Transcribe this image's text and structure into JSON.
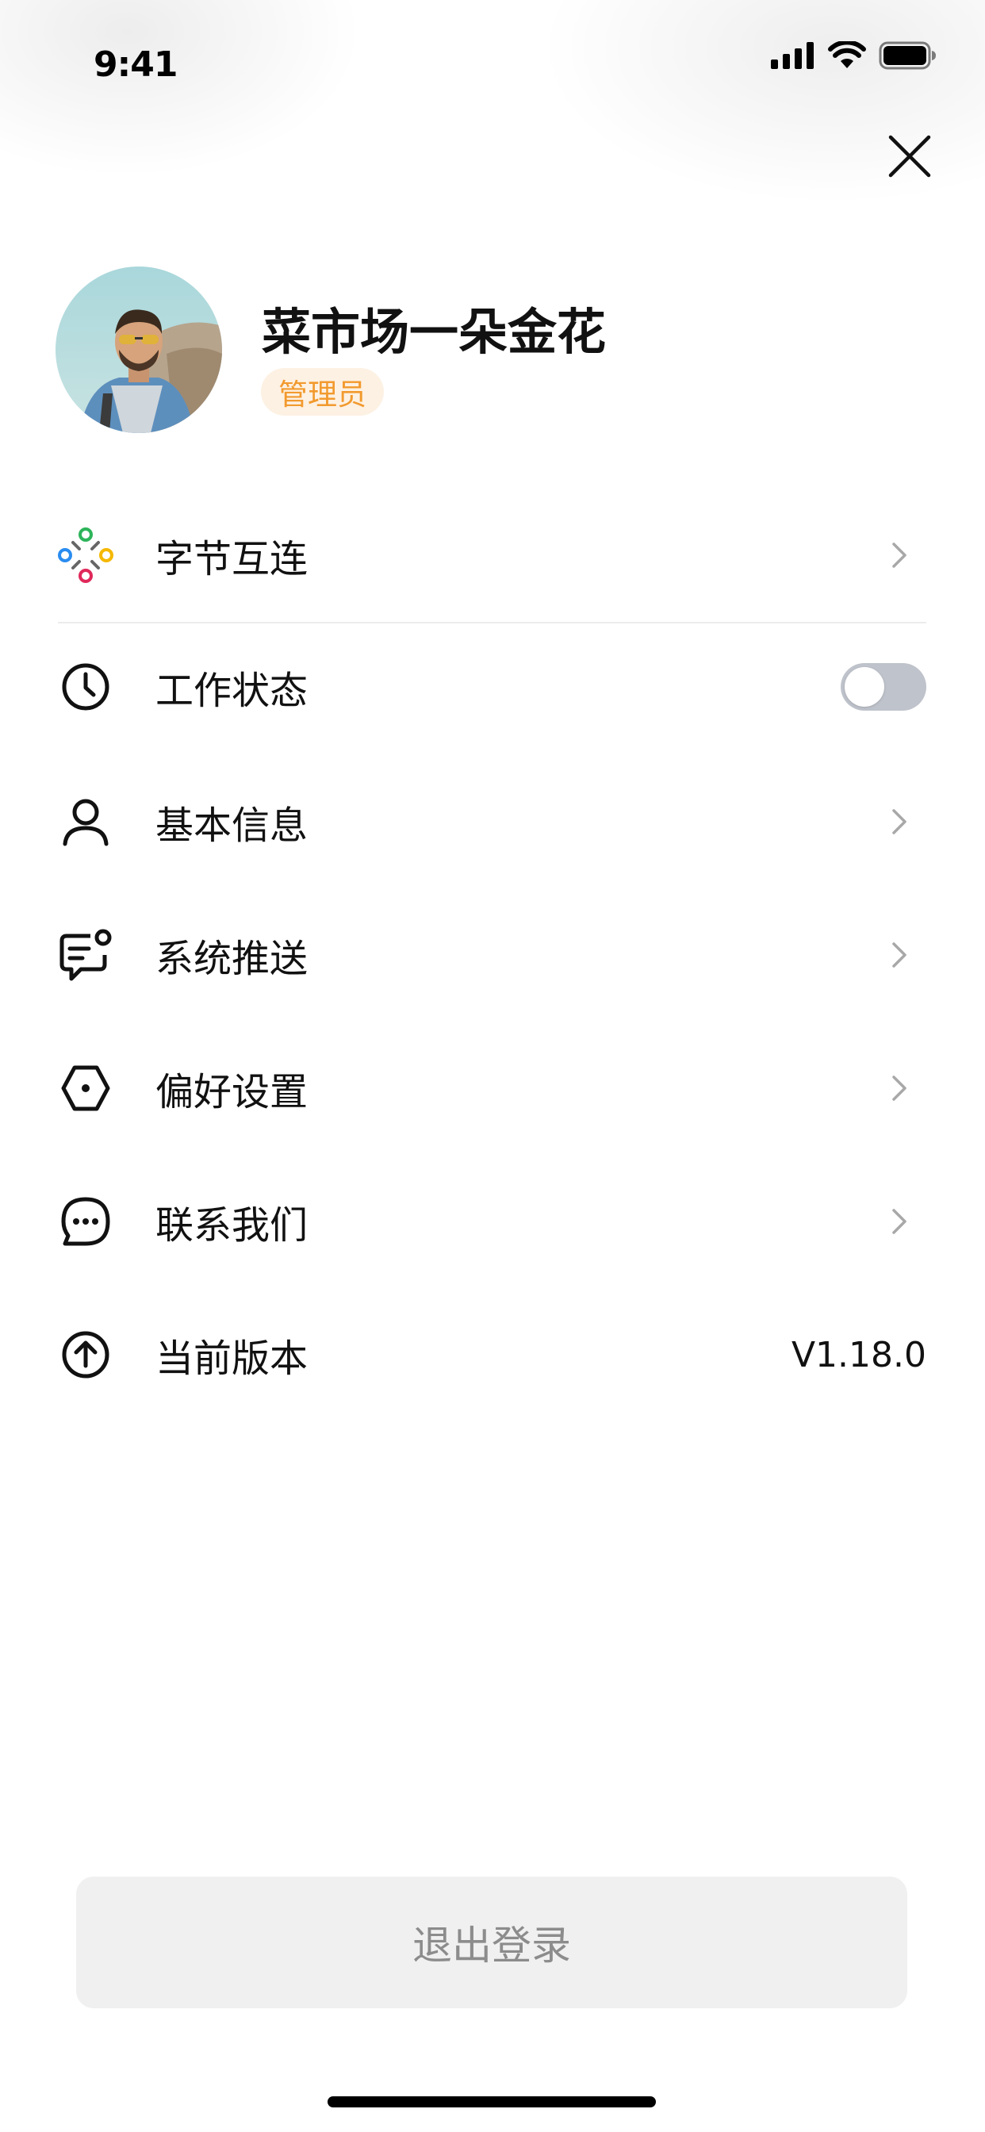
{
  "status_bar": {
    "time": "9:41"
  },
  "profile": {
    "name": "菜市场一朵金花",
    "role": "管理员"
  },
  "menu": {
    "items": [
      {
        "label": "字节互连",
        "icon": "app-grid-icon"
      },
      {
        "label": "工作状态",
        "icon": "clock-icon",
        "toggle_on": false
      },
      {
        "label": "基本信息",
        "icon": "user-icon"
      },
      {
        "label": "系统推送",
        "icon": "message-notification-icon"
      },
      {
        "label": "偏好设置",
        "icon": "settings-hexagon-icon"
      },
      {
        "label": "联系我们",
        "icon": "chat-bubble-icon"
      },
      {
        "label": "当前版本",
        "icon": "upload-circle-icon",
        "value": "V1.18.0"
      }
    ]
  },
  "logout": {
    "label": "退出登录"
  },
  "colors": {
    "badge_text": "#f29a2e",
    "badge_bg": "#fdf1e3",
    "toggle_off": "#bfc3cb",
    "logout_bg": "#f0f0f0",
    "logout_text": "#8c8c8c"
  }
}
